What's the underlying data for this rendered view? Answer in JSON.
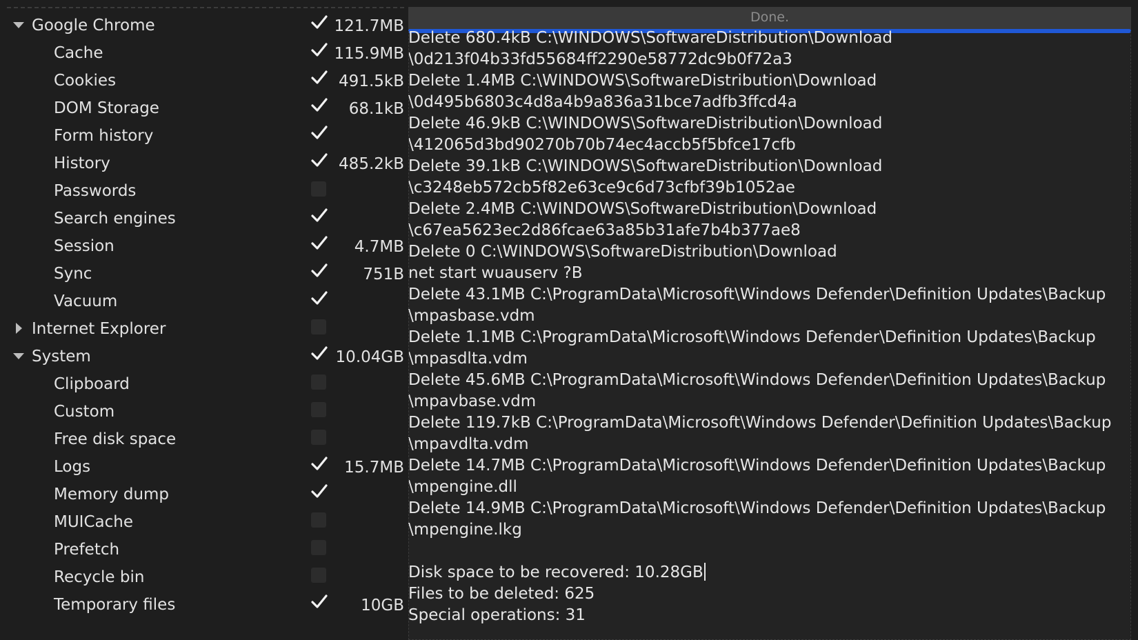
{
  "tree": [
    {
      "label": "Google Chrome",
      "level": 0,
      "expander": "expanded",
      "checked": true,
      "size": "121.7MB"
    },
    {
      "label": "Cache",
      "level": 1,
      "checked": true,
      "size": "115.9MB"
    },
    {
      "label": "Cookies",
      "level": 1,
      "checked": true,
      "size": "491.5kB"
    },
    {
      "label": "DOM Storage",
      "level": 1,
      "checked": true,
      "size": "68.1kB"
    },
    {
      "label": "Form history",
      "level": 1,
      "checked": true,
      "size": ""
    },
    {
      "label": "History",
      "level": 1,
      "checked": true,
      "size": "485.2kB"
    },
    {
      "label": "Passwords",
      "level": 1,
      "checked": false,
      "size": ""
    },
    {
      "label": "Search engines",
      "level": 1,
      "checked": true,
      "size": ""
    },
    {
      "label": "Session",
      "level": 1,
      "checked": true,
      "size": "4.7MB"
    },
    {
      "label": "Sync",
      "level": 1,
      "checked": true,
      "size": "751B"
    },
    {
      "label": "Vacuum",
      "level": 1,
      "checked": true,
      "size": ""
    },
    {
      "label": "Internet Explorer",
      "level": 0,
      "expander": "collapsed",
      "checked": false,
      "size": ""
    },
    {
      "label": "System",
      "level": 0,
      "expander": "expanded",
      "checked": true,
      "size": "10.04GB"
    },
    {
      "label": "Clipboard",
      "level": 1,
      "checked": false,
      "size": ""
    },
    {
      "label": "Custom",
      "level": 1,
      "checked": false,
      "size": ""
    },
    {
      "label": "Free disk space",
      "level": 1,
      "checked": false,
      "size": ""
    },
    {
      "label": "Logs",
      "level": 1,
      "checked": true,
      "size": "15.7MB"
    },
    {
      "label": "Memory dump",
      "level": 1,
      "checked": true,
      "size": ""
    },
    {
      "label": "MUICache",
      "level": 1,
      "checked": false,
      "size": ""
    },
    {
      "label": "Prefetch",
      "level": 1,
      "checked": false,
      "size": ""
    },
    {
      "label": "Recycle bin",
      "level": 1,
      "checked": false,
      "size": ""
    },
    {
      "label": "Temporary files",
      "level": 1,
      "checked": true,
      "size": "10GB"
    }
  ],
  "status": {
    "text": "Done.",
    "progress": 1.0
  },
  "log": [
    "Delete 680.4kB C:\\WINDOWS\\SoftwareDistribution\\Download",
    "\\0d213f04b33fd55684ff2290e58772dc9b0f72a3",
    "Delete 1.4MB C:\\WINDOWS\\SoftwareDistribution\\Download",
    "\\0d495b6803c4d8a4b9a836a31bce7adfb3ffcd4a",
    "Delete 46.9kB C:\\WINDOWS\\SoftwareDistribution\\Download",
    "\\412065d3bd90270b70b74ec4accb5f5bfce17cfb",
    "Delete 39.1kB C:\\WINDOWS\\SoftwareDistribution\\Download",
    "\\c3248eb572cb5f82e63ce9c6d73cfbf39b1052ae",
    "Delete 2.4MB C:\\WINDOWS\\SoftwareDistribution\\Download",
    "\\c67ea5623ec2d86fcae63a85b31afe7b4b377ae8",
    "Delete 0 C:\\WINDOWS\\SoftwareDistribution\\Download",
    "net start wuauserv ?B",
    "Delete 43.1MB C:\\ProgramData\\Microsoft\\Windows Defender\\Definition Updates\\Backup",
    "\\mpasbase.vdm",
    "Delete 1.1MB C:\\ProgramData\\Microsoft\\Windows Defender\\Definition Updates\\Backup",
    "\\mpasdlta.vdm",
    "Delete 45.6MB C:\\ProgramData\\Microsoft\\Windows Defender\\Definition Updates\\Backup",
    "\\mpavbase.vdm",
    "Delete 119.7kB C:\\ProgramData\\Microsoft\\Windows Defender\\Definition Updates\\Backup",
    "\\mpavdlta.vdm",
    "Delete 14.7MB C:\\ProgramData\\Microsoft\\Windows Defender\\Definition Updates\\Backup",
    "\\mpengine.dll",
    "Delete 14.9MB C:\\ProgramData\\Microsoft\\Windows Defender\\Definition Updates\\Backup",
    "\\mpengine.lkg",
    "",
    "Disk space to be recovered: 10.28GB",
    "Files to be deleted: 625",
    "Special operations: 31"
  ],
  "icons": {
    "expanded": "triangle-down-icon",
    "collapsed": "triangle-right-icon",
    "checked": "checkmark-icon"
  },
  "colors": {
    "background": "#1e1e1e",
    "progress": "#1f58d6",
    "text": "#e6e6e6"
  }
}
